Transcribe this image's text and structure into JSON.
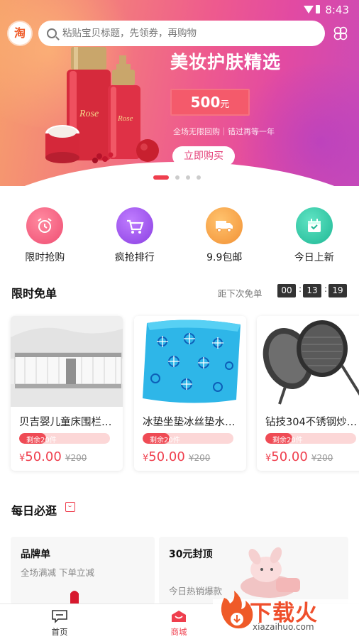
{
  "status_bar": {
    "time": "8:43"
  },
  "header": {
    "logo_text": "淘",
    "search_placeholder": "粘贴宝贝标题，先领券，再购物"
  },
  "banner": {
    "title": "美妆护肤精选",
    "price": "500",
    "price_unit": "元",
    "subtitle": "全场无限回购｜错过再等一年",
    "cta": "立即购买",
    "bottle_brand": "Rose",
    "slide_count": 4,
    "active_slide": 1
  },
  "quick_nav": [
    {
      "label": "限时抢购",
      "icon": "alarm-clock-icon",
      "color": "#f0567a"
    },
    {
      "label": "疯抢排行",
      "icon": "shopping-cart-icon",
      "color": "#9b4be8"
    },
    {
      "label": "9.9包邮",
      "icon": "delivery-truck-icon",
      "color": "#f6a34a"
    },
    {
      "label": "今日上新",
      "icon": "calendar-icon",
      "color": "#2ec6a6"
    }
  ],
  "flash": {
    "title": "限时免单",
    "countdown_label": "距下次免单",
    "hours": "00",
    "minutes": "13",
    "seconds": "19",
    "products": [
      {
        "name": "贝吉婴儿童床围栏…",
        "remaining": "剩余20件",
        "stock_fraction": 0.3,
        "currency": "¥",
        "price": "50.00",
        "old_price": "¥200",
        "image": "crib-rail"
      },
      {
        "name": "冰垫坐垫冰丝垫水…",
        "remaining": "剩余20件",
        "stock_fraction": 0.3,
        "currency": "¥",
        "price": "50.00",
        "old_price": "¥200",
        "image": "ice-cushion"
      },
      {
        "name": "钻技304不锈钢炒…",
        "remaining": "剩余20件",
        "stock_fraction": 0.3,
        "currency": "¥",
        "price": "50.00",
        "old_price": "¥200",
        "image": "steel-wok"
      }
    ]
  },
  "daily": {
    "title": "每日必逛",
    "tiles": [
      {
        "title": "品牌单",
        "subtitle": "全场满减 下单立减"
      },
      {
        "title": "30元封顶",
        "subtitle": "今日热销爆款"
      }
    ]
  },
  "tabbar": {
    "home": "首页",
    "mall": "商城"
  },
  "watermark": {
    "text": "下载火",
    "url": "xiazaihuo.com"
  },
  "colors": {
    "accent": "#ef3f4e",
    "brand_orange": "#ef5a28"
  }
}
